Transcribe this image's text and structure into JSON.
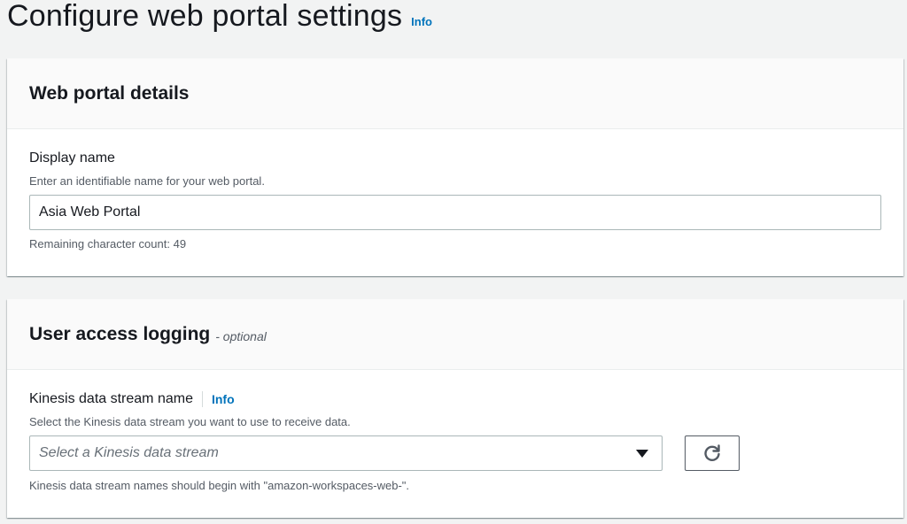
{
  "page": {
    "title": "Configure web portal settings",
    "info_label": "Info"
  },
  "web_portal_details": {
    "title": "Web portal details",
    "display_name": {
      "label": "Display name",
      "description": "Enter an identifiable name for your web portal.",
      "value": "Asia Web Portal",
      "constraint": "Remaining character count: 49"
    }
  },
  "user_access_logging": {
    "title": "User access logging",
    "optional_label": "- optional",
    "kinesis": {
      "label": "Kinesis data stream name",
      "info_label": "Info",
      "description": "Select the Kinesis data stream you want to use to receive data.",
      "placeholder": "Select a Kinesis data stream",
      "constraint": "Kinesis data stream names should begin with \"amazon-workspaces-web-\"."
    },
    "refresh_icon": "refresh-icon"
  },
  "colors": {
    "background": "#f2f3f3",
    "link": "#0073bb",
    "text": "#16191f",
    "secondary_text": "#545b64"
  }
}
